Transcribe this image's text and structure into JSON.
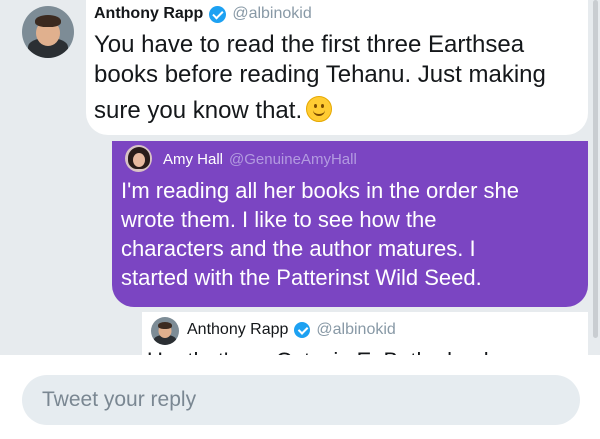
{
  "tweets": [
    {
      "name": "Anthony Rapp",
      "handle": "@albinokid",
      "verified": true,
      "lines": [
        "You have to read the first three Earthsea",
        "books before reading Tehanu. Just making",
        "sure you know that."
      ],
      "emoji": "slightly-smiling-face"
    },
    {
      "name": "Amy Hall",
      "handle": "@GenuineAmyHall",
      "verified": false,
      "lines": [
        "I'm reading all her books in the order she",
        "wrote them.  I like to see how the",
        "characters and the author matures.  I",
        "started with the Patterinst Wild Seed."
      ]
    },
    {
      "name": "Anthony Rapp",
      "handle": "@albinokid",
      "verified": true,
      "lines": [
        "Um that's an Octavia E. Butler book"
      ]
    }
  ],
  "composer": {
    "placeholder": "Tweet your reply"
  },
  "colors": {
    "background": "#e7ebee",
    "incoming_bubble": "#ffffff",
    "outgoing_bubble": "#7b45c2",
    "verified": "#1da1f2",
    "handle_gray": "#8899a6"
  }
}
